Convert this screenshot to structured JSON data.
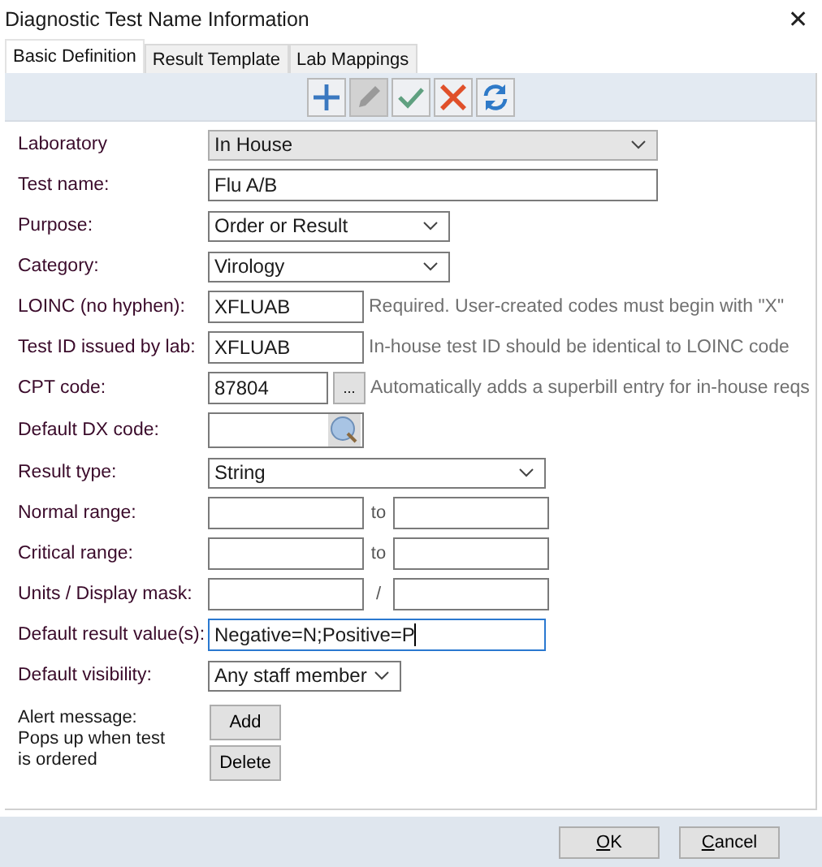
{
  "window": {
    "title": "Diagnostic Test Name Information",
    "close": "✕"
  },
  "tabs": [
    {
      "label": "Basic Definition",
      "selected": true
    },
    {
      "label": "Result Template",
      "selected": false
    },
    {
      "label": "Lab Mappings",
      "selected": false
    }
  ],
  "toolbar": [
    {
      "kind": "add",
      "disabled": false
    },
    {
      "kind": "edit",
      "disabled": true
    },
    {
      "kind": "save",
      "disabled": false
    },
    {
      "kind": "cancel",
      "disabled": false
    },
    {
      "kind": "refresh",
      "disabled": false
    }
  ],
  "fields": [
    {
      "kind": "select",
      "label": "Laboratory",
      "value": "In House"
    },
    {
      "kind": "text",
      "label": "Test name:",
      "value": "Flu A/B"
    },
    {
      "kind": "select",
      "label": "Purpose:",
      "value": "Order or Result"
    },
    {
      "kind": "select",
      "label": "Category:",
      "value": "Virology"
    },
    {
      "kind": "hint",
      "label": "LOINC (no hyphen):",
      "value": "XFLUAB",
      "hint": "Required. User-created codes must begin with \"X\""
    },
    {
      "kind": "hint",
      "label": "Test ID issued by lab:",
      "value": "XFLUAB",
      "hint": "In-house test ID should be identical to LOINC code"
    },
    {
      "kind": "cpt",
      "label": "CPT code:",
      "value": "87804",
      "button": "...",
      "hint": "Automatically adds a superbill entry for in-house reqs"
    },
    {
      "kind": "dx",
      "label": "Default DX code:"
    },
    {
      "kind": "select",
      "label": "Result type:",
      "value": "String"
    },
    {
      "kind": "pair",
      "label": "Normal range:",
      "separator": "to"
    },
    {
      "kind": "pair",
      "label": "Critical range:",
      "separator": "to"
    },
    {
      "kind": "pair",
      "label": "Units / Display mask:",
      "separator": "/"
    },
    {
      "kind": "text",
      "label": "Default result value(s):",
      "value": "Negative=N;Positive=P",
      "focused": true
    },
    {
      "kind": "select",
      "label": "Default visibility:",
      "value": "Any staff member"
    }
  ],
  "alert": {
    "label": "Alert message: Pops up when test is ordered",
    "buttons": [
      "Add",
      "Delete"
    ]
  },
  "footer": {
    "buttons": [
      "OK",
      "Cancel"
    ]
  }
}
